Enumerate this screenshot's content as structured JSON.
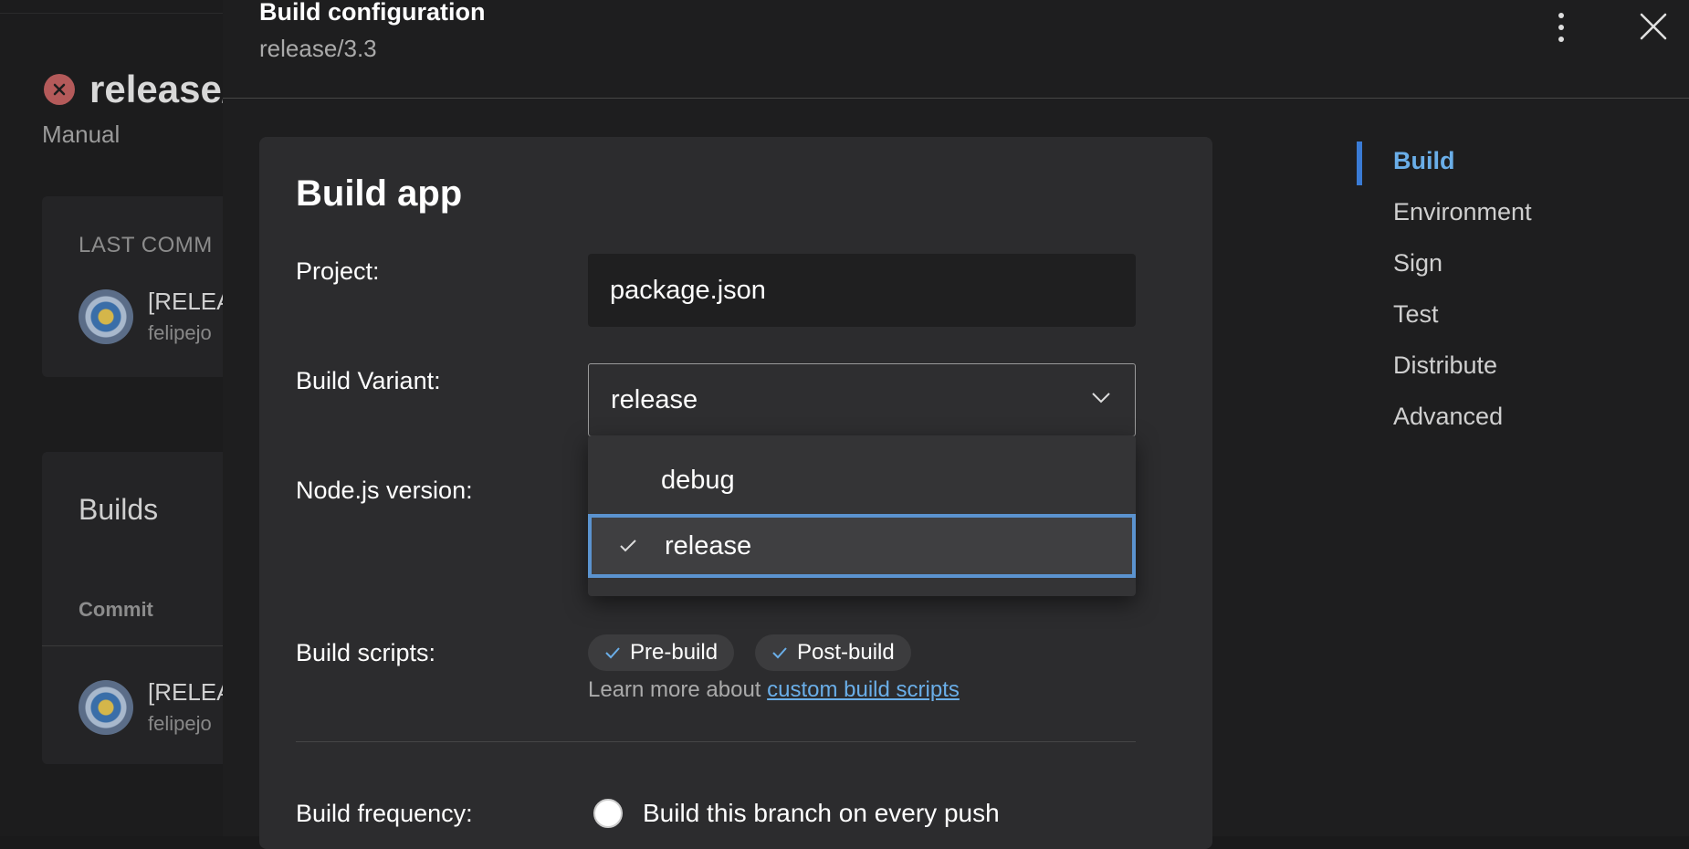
{
  "background": {
    "title": "release/",
    "subtitle": "Manual",
    "last_commit_label": "LAST COMM",
    "commit_title": "[RELEA",
    "commit_author": "felipejo",
    "builds_title": "Builds",
    "commit_column": "Commit",
    "build_commit_title": "[RELEA",
    "build_commit_author": "felipejo"
  },
  "panel": {
    "title": "Build configuration",
    "subtitle": "release/3.3"
  },
  "card": {
    "title": "Build app",
    "project_label": "Project:",
    "project_value": "package.json",
    "variant_label": "Build Variant:",
    "variant_value": "release",
    "node_label": "Node.js version:",
    "variant_options": [
      "debug",
      "release"
    ],
    "scripts_label": "Build scripts:",
    "prebuild_chip": "Pre-build",
    "postbuild_chip": "Post-build",
    "learn_more_text": "Learn more about ",
    "learn_more_link": "custom build scripts",
    "frequency_label": "Build frequency:",
    "frequency_option": "Build this branch on every push"
  },
  "nav": {
    "items": [
      "Build",
      "Environment",
      "Sign",
      "Test",
      "Distribute",
      "Advanced"
    ]
  },
  "colors": {
    "accent": "#6aaee8",
    "selection_border": "#5b93cf",
    "error": "#b45a5a"
  }
}
